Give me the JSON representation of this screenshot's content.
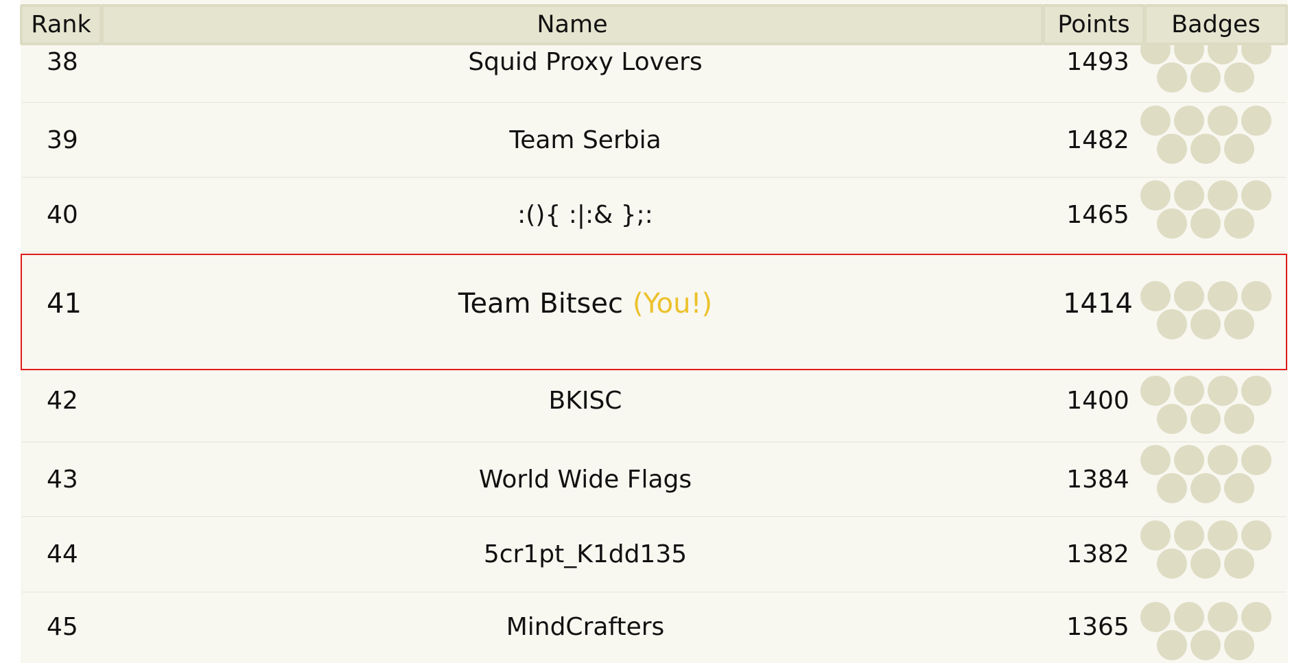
{
  "table": {
    "columns": {
      "rank": "Rank",
      "name": "Name",
      "points": "Points",
      "badges": "Badges"
    },
    "you_tag": "(You!)",
    "rows": [
      {
        "rank": "38",
        "name": "Squid Proxy Lovers",
        "points": "1493",
        "badges_shown": 7
      },
      {
        "rank": "39",
        "name": "Team Serbia",
        "points": "1482",
        "badges_shown": 7
      },
      {
        "rank": "40",
        "name": ":(){ :|:& };:",
        "points": "1465",
        "badges_shown": 7
      },
      {
        "rank": "41",
        "name": "Team Bitsec",
        "points": "1414",
        "badges_shown": 7,
        "is_you": true
      },
      {
        "rank": "42",
        "name": "BKISC",
        "points": "1400",
        "badges_shown": 7
      },
      {
        "rank": "43",
        "name": "World Wide Flags",
        "points": "1384",
        "badges_shown": 7
      },
      {
        "rank": "44",
        "name": "5cr1pt_K1dd135",
        "points": "1382",
        "badges_shown": 7
      },
      {
        "rank": "45",
        "name": "MindCrafters",
        "points": "1365",
        "badges_shown": 7
      }
    ]
  },
  "colors": {
    "background": "#f8f7f0",
    "header": "#e5e4cf",
    "highlight_border": "#e01b1b",
    "you_tag": "#ecc12b",
    "badge_empty": "#dedcc3"
  }
}
